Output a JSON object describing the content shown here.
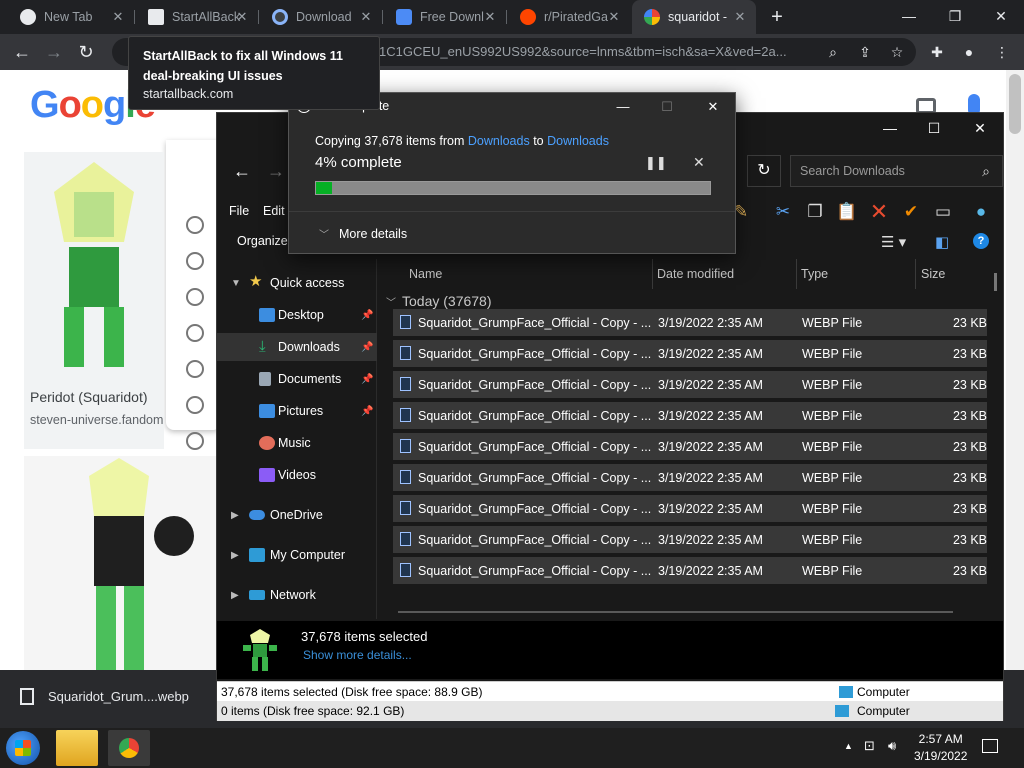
{
  "chrome": {
    "tabs": [
      {
        "label": "New Tab",
        "color": "#e8eaed"
      },
      {
        "label": "StartAllBack",
        "color": "#e8eaed"
      },
      {
        "label": "Download",
        "color": "#8ab4f8"
      },
      {
        "label": "Free Downl",
        "color": "#4c8bf5"
      },
      {
        "label": "r/PiratedGa",
        "color": "#ff4500"
      },
      {
        "label": "squaridot -",
        "color": "#ffffff"
      }
    ],
    "active_tab_index": 5,
    "url_fragment": "1C1GCEU_enUS992US992&source=lnms&tbm=isch&sa=X&ved=2a...",
    "tooltip": {
      "title": "StartAllBack to fix all Windows 11 deal-breaking UI issues",
      "domain": "startallback.com"
    }
  },
  "google": {
    "result_title": "Peridot (Squaridot)",
    "result_site": "steven-universe.fandom"
  },
  "download_shelf": {
    "filename": "Squaridot_Grum....webp"
  },
  "copy_dialog": {
    "title": "4% complete",
    "prefix": "Copying 37,678 items from",
    "from": "Downloads",
    "to_word": "to",
    "to": "Downloads",
    "percent_text": "4% complete",
    "progress": 0.04,
    "more_details": "More details"
  },
  "explorer": {
    "search_placeholder": "Search Downloads",
    "menu": [
      "File",
      "Edit"
    ],
    "organize": "Organize",
    "nav": {
      "quick_access": "Quick access",
      "items": [
        {
          "label": "Desktop",
          "color": "#3c8de0"
        },
        {
          "label": "Downloads",
          "color": "#2bb673"
        },
        {
          "label": "Documents",
          "color": "#9aa7b4"
        },
        {
          "label": "Pictures",
          "color": "#3c8de0"
        },
        {
          "label": "Music",
          "color": "#e26d5a"
        },
        {
          "label": "Videos",
          "color": "#8b5cf6"
        }
      ],
      "onedrive": "OneDrive",
      "my_computer": "My Computer",
      "network": "Network"
    },
    "columns": {
      "name": "Name",
      "date": "Date modified",
      "type": "Type",
      "size": "Size"
    },
    "group_label": "Today (37678)",
    "rows": [
      {
        "name": "Squaridot_GrumpFace_Official - Copy - ...",
        "date": "3/19/2022 2:35 AM",
        "type": "WEBP File",
        "size": "23 KB"
      },
      {
        "name": "Squaridot_GrumpFace_Official - Copy - ...",
        "date": "3/19/2022 2:35 AM",
        "type": "WEBP File",
        "size": "23 KB"
      },
      {
        "name": "Squaridot_GrumpFace_Official - Copy - ...",
        "date": "3/19/2022 2:35 AM",
        "type": "WEBP File",
        "size": "23 KB"
      },
      {
        "name": "Squaridot_GrumpFace_Official - Copy - ...",
        "date": "3/19/2022 2:35 AM",
        "type": "WEBP File",
        "size": "23 KB"
      },
      {
        "name": "Squaridot_GrumpFace_Official - Copy - ...",
        "date": "3/19/2022 2:35 AM",
        "type": "WEBP File",
        "size": "23 KB"
      },
      {
        "name": "Squaridot_GrumpFace_Official - Copy - ...",
        "date": "3/19/2022 2:35 AM",
        "type": "WEBP File",
        "size": "23 KB"
      },
      {
        "name": "Squaridot_GrumpFace_Official - Copy - ...",
        "date": "3/19/2022 2:35 AM",
        "type": "WEBP File",
        "size": "23 KB"
      },
      {
        "name": "Squaridot_GrumpFace_Official - Copy - ...",
        "date": "3/19/2022 2:35 AM",
        "type": "WEBP File",
        "size": "23 KB"
      },
      {
        "name": "Squaridot_GrumpFace_Official - Copy - ...",
        "date": "3/19/2022 2:35 AM",
        "type": "WEBP File",
        "size": "23 KB"
      }
    ],
    "details": {
      "selected": "37,678 items selected",
      "show_more": "Show more details..."
    },
    "status_bar_1": "37,678 items selected (Disk free space: 88.9 GB)",
    "status_bar_2": "0 items (Disk free space: 92.1 GB)",
    "status_computer": "Computer"
  },
  "taskbar": {
    "time": "2:57 AM",
    "date": "3/19/2022"
  }
}
